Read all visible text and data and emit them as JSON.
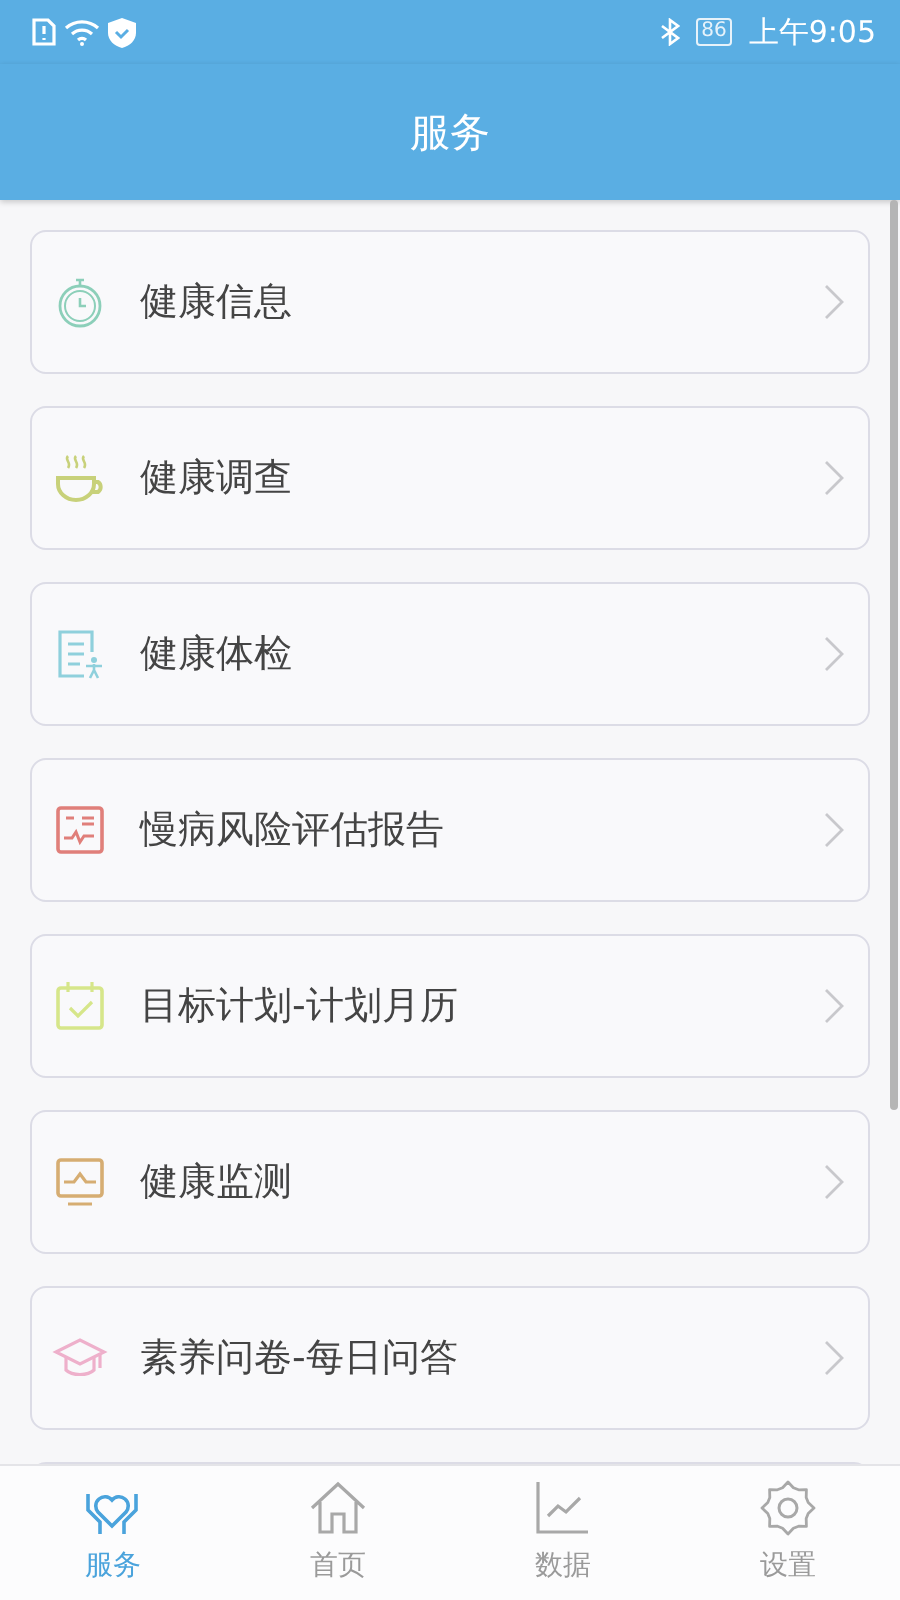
{
  "status_bar": {
    "battery": "86",
    "time": "上午9:05"
  },
  "header": {
    "title": "服务"
  },
  "items": [
    {
      "label": "健康信息",
      "color": "#8ccfb9"
    },
    {
      "label": "健康调查",
      "color": "#c8d17a"
    },
    {
      "label": "健康体检",
      "color": "#8fd0dc"
    },
    {
      "label": "慢病风险评估报告",
      "color": "#e07f7a"
    },
    {
      "label": "目标计划-计划月历",
      "color": "#d6e68a"
    },
    {
      "label": "健康监测",
      "color": "#d6ad72"
    },
    {
      "label": "素养问卷-每日问答",
      "color": "#eeb0cb"
    }
  ],
  "more_below": true,
  "tabs": [
    {
      "label": "服务",
      "selected": true
    },
    {
      "label": "首页",
      "selected": false
    },
    {
      "label": "数据",
      "selected": false
    },
    {
      "label": "设置",
      "selected": false
    }
  ]
}
